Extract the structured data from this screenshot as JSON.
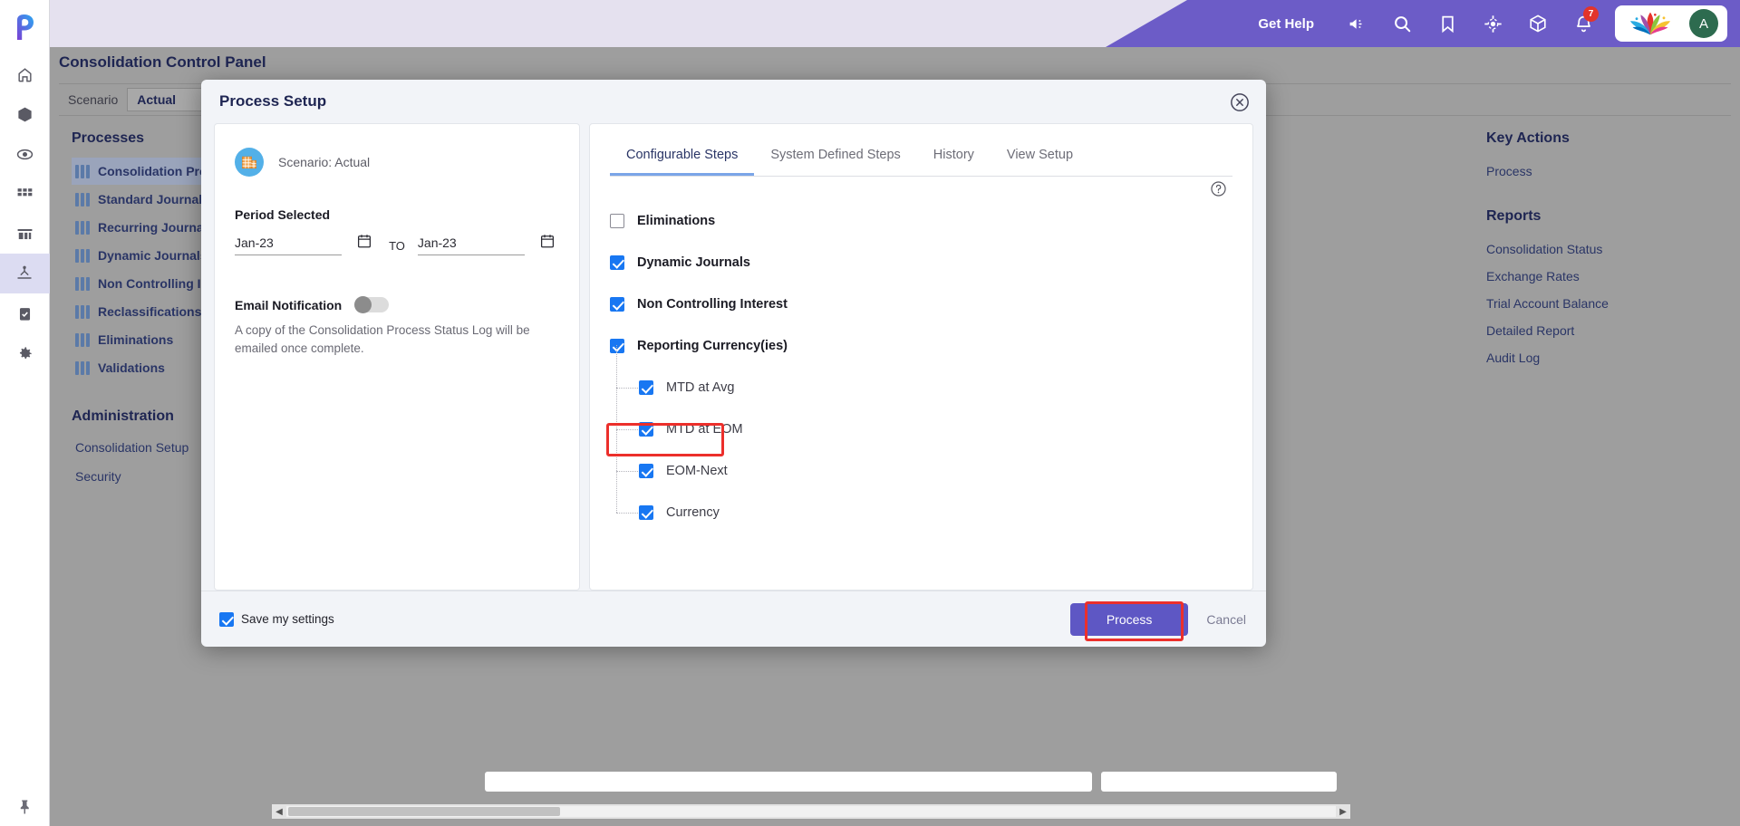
{
  "topbar": {
    "get_help": "Get Help",
    "notification_count": "7",
    "avatar_initial": "A",
    "icons": [
      "megaphone-icon",
      "search-icon",
      "bookmark-icon",
      "target-icon",
      "cube-icon",
      "bell-icon"
    ],
    "accent_color": "#6c5cc7"
  },
  "rail": {
    "items": [
      {
        "name": "home-icon"
      },
      {
        "name": "cube-icon"
      },
      {
        "name": "eye-icon"
      },
      {
        "name": "grid-icon"
      },
      {
        "name": "chart-icon"
      },
      {
        "name": "consolidation-icon"
      },
      {
        "name": "clipboard-check-icon"
      },
      {
        "name": "gear-icon"
      }
    ],
    "pin_icon": "pin-icon"
  },
  "page": {
    "title": "Consolidation Control Panel",
    "scenario_label": "Scenario",
    "scenario_value": "Actual",
    "nav": {
      "processes_heading": "Processes",
      "processes": [
        "Consolidation Process",
        "Standard Journals",
        "Recurring Journals",
        "Dynamic Journals",
        "Non Controlling Interest",
        "Reclassifications",
        "Eliminations",
        "Validations"
      ],
      "selected_process": "Consolidation Process",
      "administration_heading": "Administration",
      "administration": [
        "Consolidation Setup",
        "Security"
      ]
    },
    "right": {
      "actions_heading": "Key Actions",
      "actions": [
        "Process"
      ],
      "reports_heading": "Reports",
      "reports": [
        "Consolidation Status",
        "Exchange Rates",
        "Trial Account Balance",
        "Detailed Report",
        "Audit Log"
      ]
    }
  },
  "modal": {
    "title": "Process Setup",
    "close_icon": "close-icon",
    "left": {
      "scenario_icon": "building-icon",
      "scenario_text": "Scenario: Actual",
      "period_label": "Period Selected",
      "period_from": "Jan-23",
      "period_to": "Jan-23",
      "to_text": "TO",
      "calendar_icon": "calendar-icon",
      "email_label": "Email Notification",
      "email_toggle_state": "off",
      "email_description": "A copy of the Consolidation Process Status Log will be emailed once complete."
    },
    "right": {
      "tabs": [
        {
          "label": "Configurable Steps",
          "active": true
        },
        {
          "label": "System Defined Steps",
          "active": false
        },
        {
          "label": "History",
          "active": false
        },
        {
          "label": "View Setup",
          "active": false
        }
      ],
      "help_icon": "help-circle-icon",
      "steps": [
        {
          "label": "Eliminations",
          "checked": false,
          "level": 0
        },
        {
          "label": "Dynamic Journals",
          "checked": true,
          "level": 0
        },
        {
          "label": "Non Controlling Interest",
          "checked": true,
          "level": 0
        },
        {
          "label": "Reporting Currency(ies)",
          "checked": true,
          "level": 0
        },
        {
          "label": "MTD at Avg",
          "checked": true,
          "level": 1
        },
        {
          "label": "MTD at EOM",
          "checked": true,
          "level": 1
        },
        {
          "label": "EOM-Next",
          "checked": true,
          "level": 1
        },
        {
          "label": "Currency",
          "checked": true,
          "level": 1,
          "highlighted": true
        }
      ]
    },
    "footer": {
      "save_label": "Save my settings",
      "save_checked": true,
      "process_label": "Process",
      "cancel_label": "Cancel",
      "highlight_color": "#ec2f2b"
    }
  }
}
